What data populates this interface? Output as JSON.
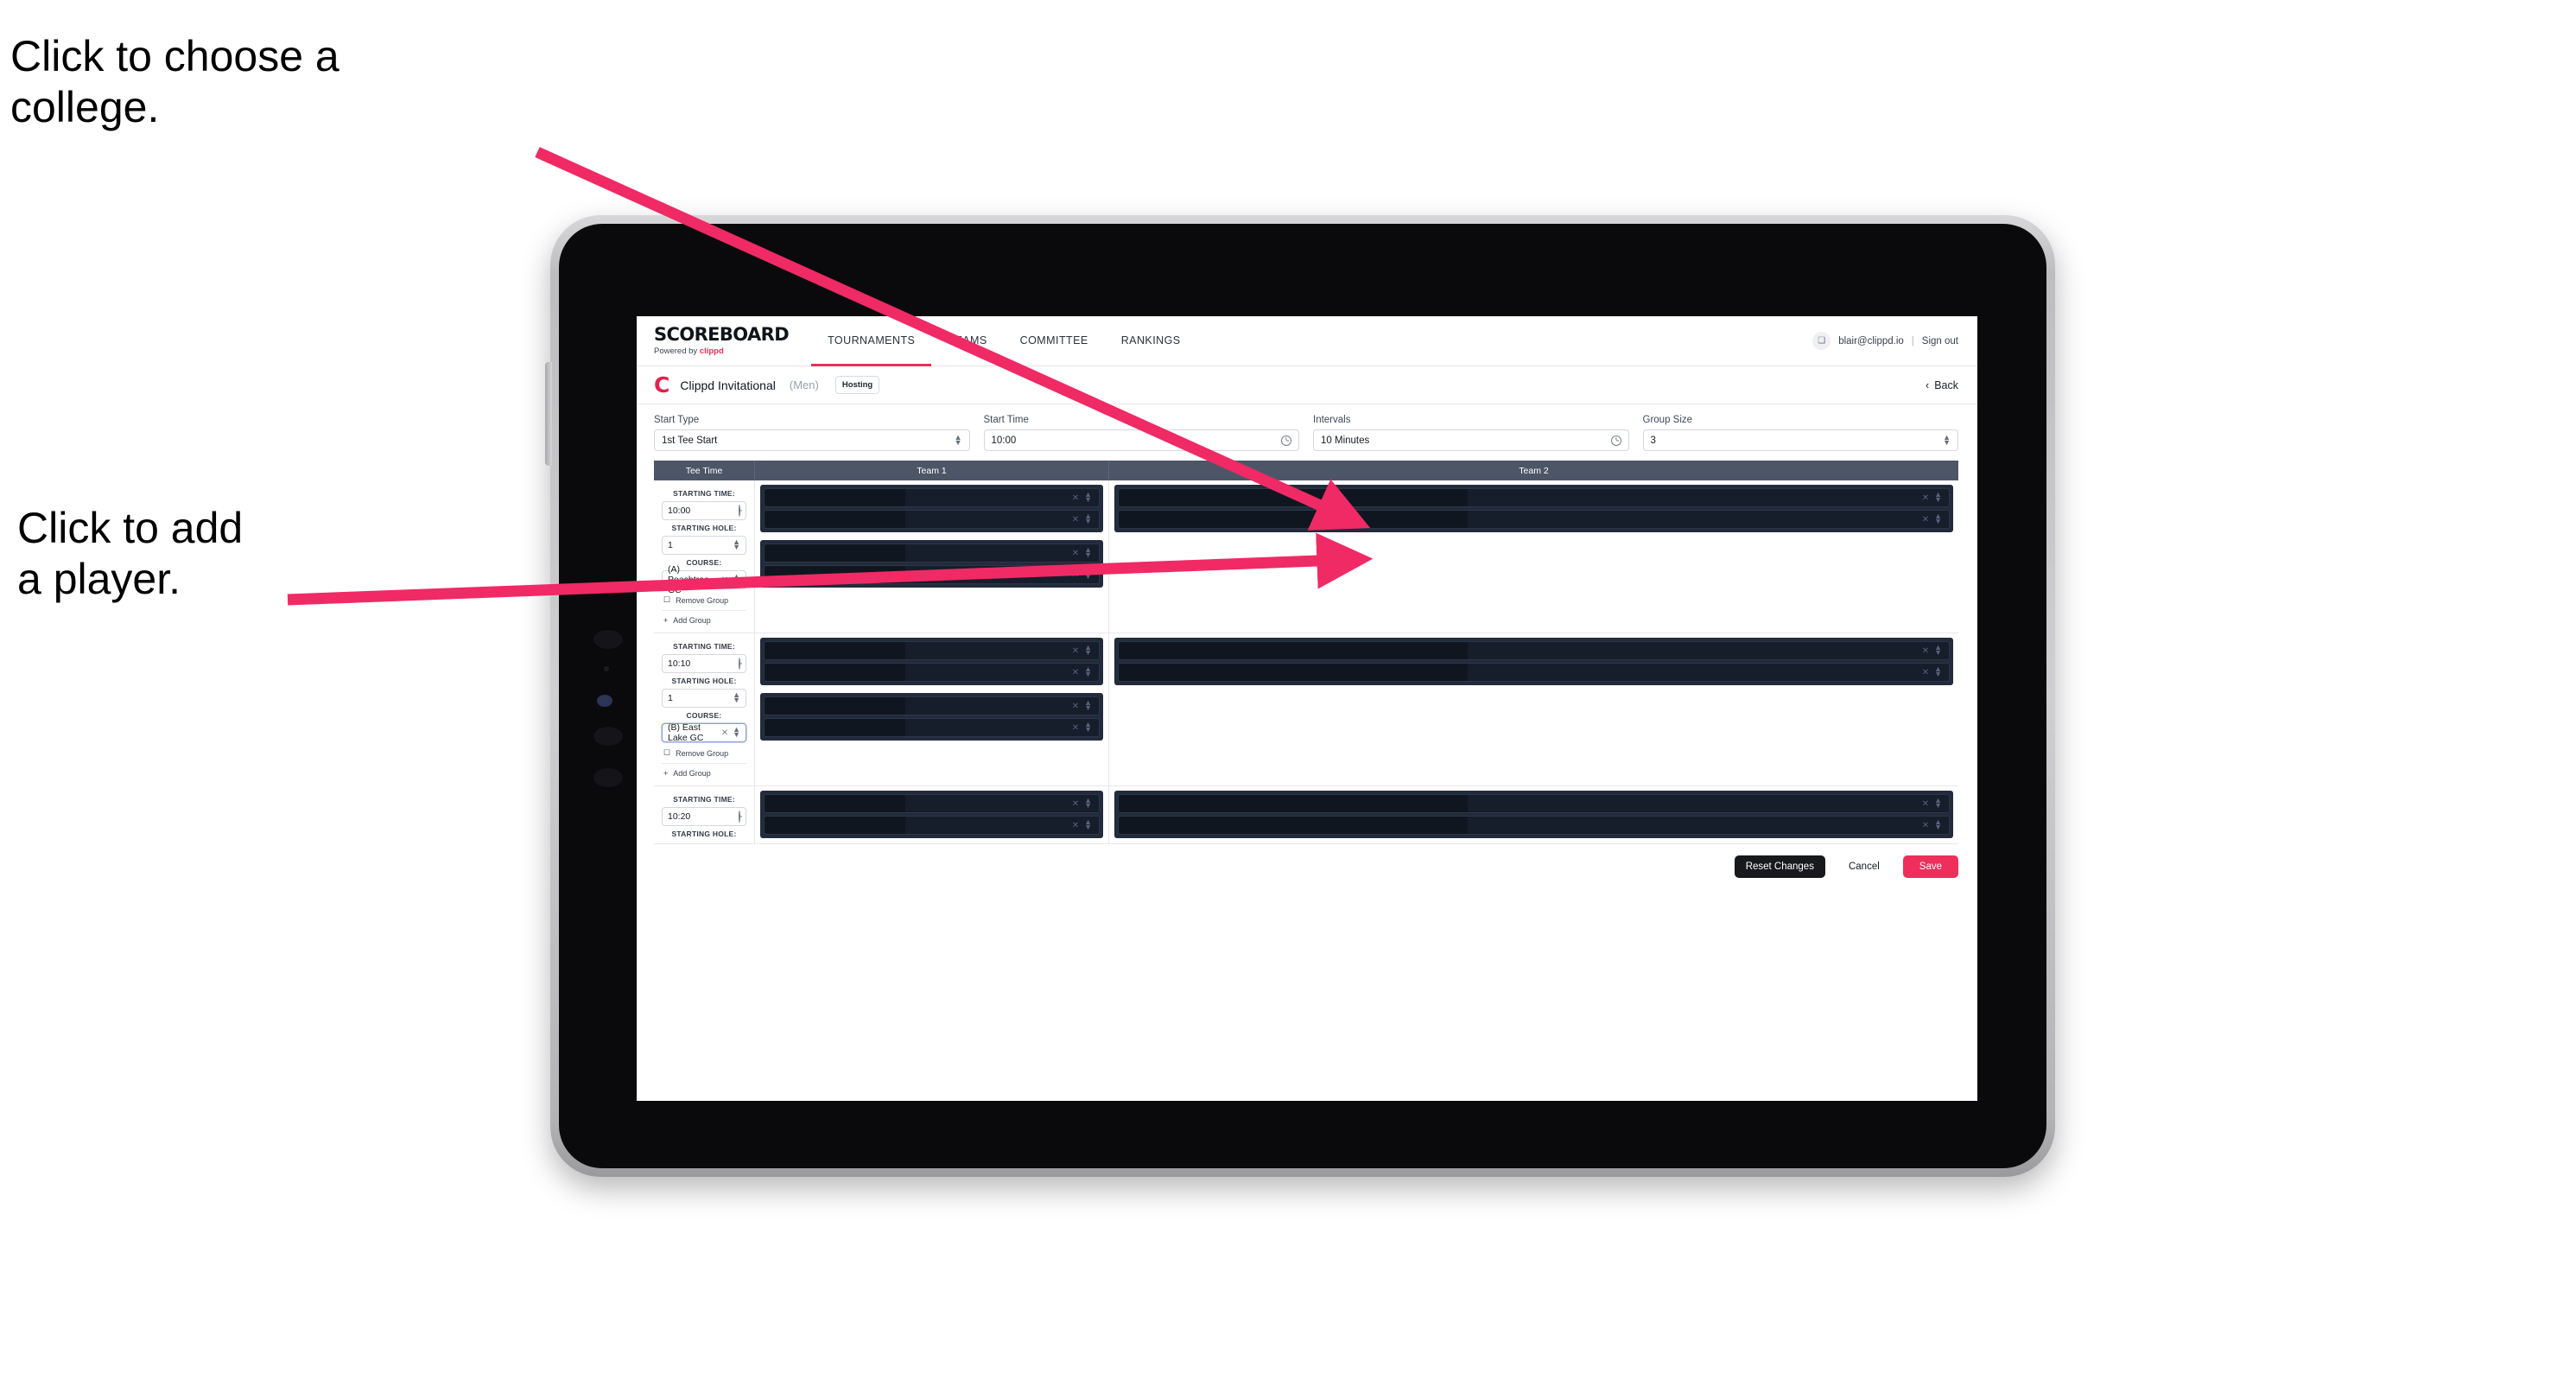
{
  "annotations": {
    "college": "Click to choose a\ncollege.",
    "player": "Click to add\na player.",
    "arrow_color": "#ef2a64"
  },
  "topnav": {
    "brand_word": "SCOREBOARD",
    "brand_sub_prefix": "Powered by ",
    "brand_sub_name": "clippd",
    "tabs": [
      {
        "label": "TOURNAMENTS",
        "active": true
      },
      {
        "label": "TEAMS",
        "active": false
      },
      {
        "label": "COMMITTEE",
        "active": false
      },
      {
        "label": "RANKINGS",
        "active": false
      }
    ],
    "avatar_glyph": "❑",
    "user_email": "blair@clippd.io",
    "separator": "|",
    "sign_out": "Sign out"
  },
  "tournament_bar": {
    "logo_glyph": "C",
    "name": "Clippd Invitational",
    "gender": "(Men)",
    "badge": "Hosting",
    "back_chevron": "‹",
    "back_label": "Back"
  },
  "settings": [
    {
      "label": "Start Type",
      "value": "1st Tee Start",
      "icon": "stepper-icon"
    },
    {
      "label": "Start Time",
      "value": "10:00",
      "icon": "clock-icon"
    },
    {
      "label": "Intervals",
      "value": "10 Minutes",
      "icon": "clock-icon"
    },
    {
      "label": "Group Size",
      "value": "3",
      "icon": "stepper-icon"
    }
  ],
  "table": {
    "headers": {
      "tee_time": "Tee Time",
      "team1": "Team 1",
      "team2": "Team 2"
    },
    "labels": {
      "starting_time": "STARTING TIME:",
      "starting_hole": "STARTING HOLE:",
      "course": "COURSE:",
      "remove_group": "Remove Group",
      "add_group": "Add Group",
      "trash_glyph": "☐",
      "plus_glyph": "+",
      "clear_glyph": "✕"
    },
    "groups": [
      {
        "starting_time": "10:00",
        "starting_hole": "1",
        "course": "(A) Peachtree GC",
        "course_focused": false,
        "team1_blocks": [
          2,
          2
        ],
        "team2_blocks": [
          2
        ]
      },
      {
        "starting_time": "10:10",
        "starting_hole": "1",
        "course": "(B) East Lake GC",
        "course_focused": true,
        "team1_blocks": [
          2,
          2
        ],
        "team2_blocks": [
          2
        ]
      },
      {
        "starting_time": "10:20",
        "starting_hole": "",
        "course": "",
        "course_focused": false,
        "team1_blocks": [
          2
        ],
        "team2_blocks": [
          2
        ]
      }
    ]
  },
  "footer": {
    "reset": "Reset Changes",
    "cancel": "Cancel",
    "save": "Save"
  }
}
